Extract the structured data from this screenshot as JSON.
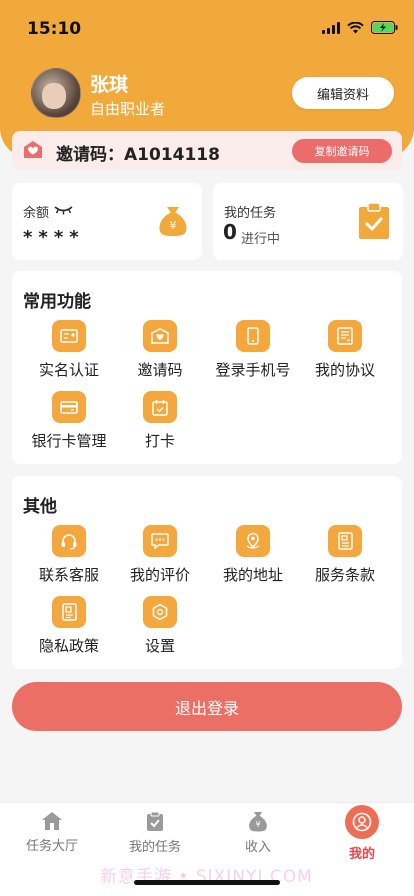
{
  "status_bar": {
    "time": "15:10"
  },
  "profile": {
    "name": "张琪",
    "role": "自由职业者",
    "edit_label": "编辑资料"
  },
  "invite": {
    "label": "邀请码：A1014118",
    "copy_label": "复制邀请码"
  },
  "balance": {
    "label": "余额",
    "masked_value": "****"
  },
  "tasks": {
    "label": "我的任务",
    "count": "0",
    "status": "进行中"
  },
  "common_functions": {
    "title": "常用功能",
    "items": [
      {
        "label": "实名认证",
        "icon": "id-card-icon"
      },
      {
        "label": "邀请码",
        "icon": "invite-envelope-icon"
      },
      {
        "label": "登录手机号",
        "icon": "phone-icon"
      },
      {
        "label": "我的协议",
        "icon": "agreement-icon"
      },
      {
        "label": "银行卡管理",
        "icon": "bank-card-icon"
      },
      {
        "label": "打卡",
        "icon": "calendar-check-icon"
      }
    ]
  },
  "other_functions": {
    "title": "其他",
    "items": [
      {
        "label": "联系客服",
        "icon": "headset-icon"
      },
      {
        "label": "我的评价",
        "icon": "chat-bubble-icon"
      },
      {
        "label": "我的地址",
        "icon": "map-pin-icon"
      },
      {
        "label": "服务条款",
        "icon": "document-icon"
      },
      {
        "label": "隐私政策",
        "icon": "privacy-doc-icon"
      },
      {
        "label": "设置",
        "icon": "gear-icon"
      }
    ]
  },
  "logout": {
    "label": "退出登录"
  },
  "tabbar": {
    "tabs": [
      {
        "label": "任务大厅",
        "icon": "home-icon"
      },
      {
        "label": "我的任务",
        "icon": "task-clipboard-icon"
      },
      {
        "label": "收入",
        "icon": "money-bag-icon"
      },
      {
        "label": "我的",
        "icon": "user-icon"
      }
    ],
    "active": "我的"
  },
  "watermark": "新意手游 • SIXINYI.COM",
  "colors": {
    "accent": "#f2a93b",
    "danger": "#ec6b6b",
    "active_tab": "#e7474b"
  }
}
